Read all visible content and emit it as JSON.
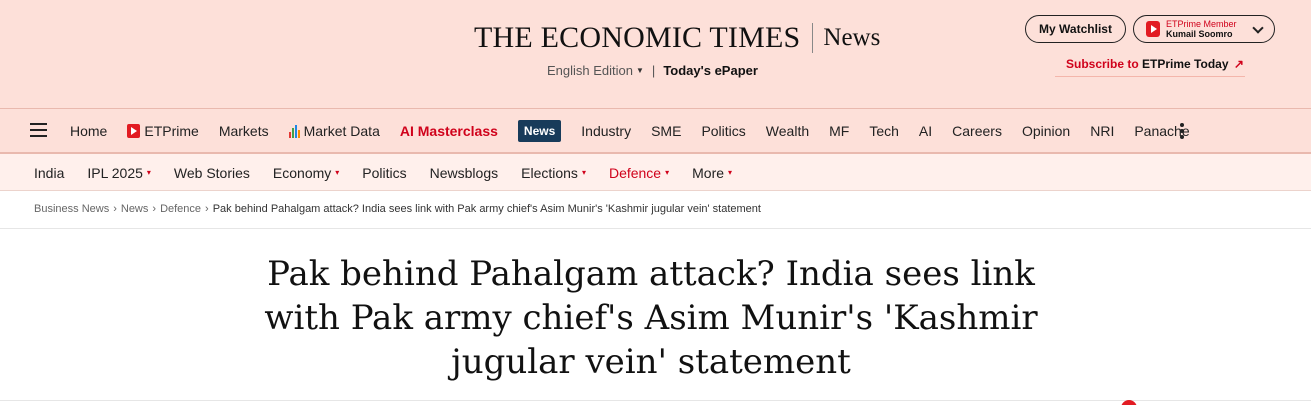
{
  "masthead": {
    "logo_title": "THE ECONOMIC TIMES",
    "section": "News",
    "edition": "English Edition",
    "epaper": "Today's ePaper",
    "watchlist": "My Watchlist",
    "member_label": "ETPrime Member",
    "member_name": "Kumail Soomro",
    "subscribe_prefix": "Subscribe to",
    "subscribe_brand": "ETPrime Today",
    "subscribe_arrow": "↗"
  },
  "mainnav": {
    "items": [
      {
        "label": "Home"
      },
      {
        "label": "ETPrime"
      },
      {
        "label": "Markets"
      },
      {
        "label": "Market Data"
      },
      {
        "label": "AI Masterclass"
      },
      {
        "label": "News"
      },
      {
        "label": "Industry"
      },
      {
        "label": "SME"
      },
      {
        "label": "Politics"
      },
      {
        "label": "Wealth"
      },
      {
        "label": "MF"
      },
      {
        "label": "Tech"
      },
      {
        "label": "AI"
      },
      {
        "label": "Careers"
      },
      {
        "label": "Opinion"
      },
      {
        "label": "NRI"
      },
      {
        "label": "Panache"
      }
    ]
  },
  "subnav": {
    "items": [
      {
        "label": "India"
      },
      {
        "label": "IPL 2025"
      },
      {
        "label": "Web Stories"
      },
      {
        "label": "Economy"
      },
      {
        "label": "Politics"
      },
      {
        "label": "Newsblogs"
      },
      {
        "label": "Elections"
      },
      {
        "label": "Defence"
      },
      {
        "label": "More"
      }
    ],
    "dropdown_glyph": "▾"
  },
  "breadcrumb": {
    "items": [
      "Business News",
      "News",
      "Defence"
    ],
    "current": "Pak behind Pahalgam attack? India sees link with Pak army chief's Asim Munir's 'Kashmir jugular vein' statement",
    "separator": "›"
  },
  "article": {
    "headline": "Pak behind Pahalgam attack? India sees link with Pak army chief's Asim Munir's 'Kashmir jugular vein' statement"
  },
  "colors": {
    "masthead_bg": "#fde0d9",
    "accent_red": "#d0021b",
    "active_tab_bg": "#183b5a"
  },
  "icons": [
    "menu-icon",
    "etprime-icon",
    "market-data-icon",
    "more-options-icon",
    "chevron-down-icon"
  ]
}
